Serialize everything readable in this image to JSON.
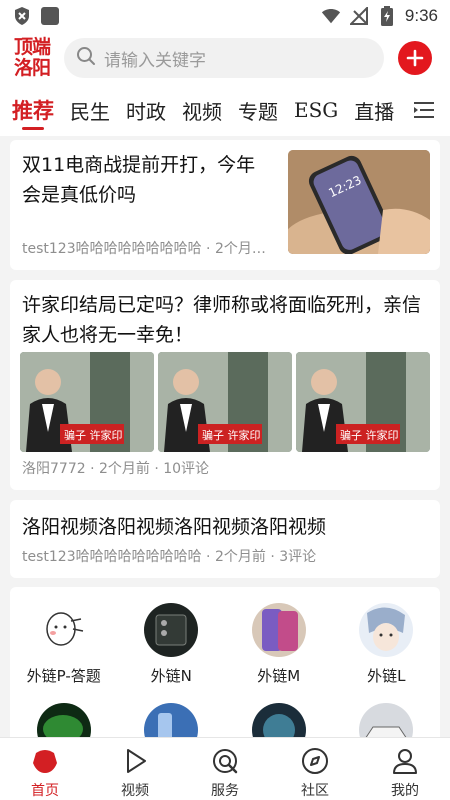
{
  "status_bar": {
    "time": "9:36"
  },
  "header": {
    "logo_line1": "顶端",
    "logo_line2": "洛阳",
    "search_placeholder": "请输入关键字"
  },
  "tabs": [
    "推荐",
    "民生",
    "时政",
    "视频",
    "专题",
    "ESG",
    "直播"
  ],
  "articles": [
    {
      "title": "双11电商战提前开打，今年会是真低价吗",
      "meta": "test123哈哈哈哈哈哈哈哈哈 · 2个月…",
      "thumb_text": "12:23"
    },
    {
      "title": "许家印结局已定吗？律师称或将面临死刑，亲信家人也将无一幸免！",
      "meta": "洛阳7772 · 2个月前 · 10评论",
      "banner_text": "骗子 许家印"
    },
    {
      "title": "洛阳视频洛阳视频洛阳视频洛阳视频",
      "meta": "test123哈哈哈哈哈哈哈哈哈 · 2个月前 · 3评论"
    }
  ],
  "grid_items": [
    "外链P-答题",
    "外链N",
    "外链M",
    "外链L"
  ],
  "bottom_nav": [
    "首页",
    "视频",
    "服务",
    "社区",
    "我的"
  ],
  "colors": {
    "brand_red": "#d31f23"
  }
}
